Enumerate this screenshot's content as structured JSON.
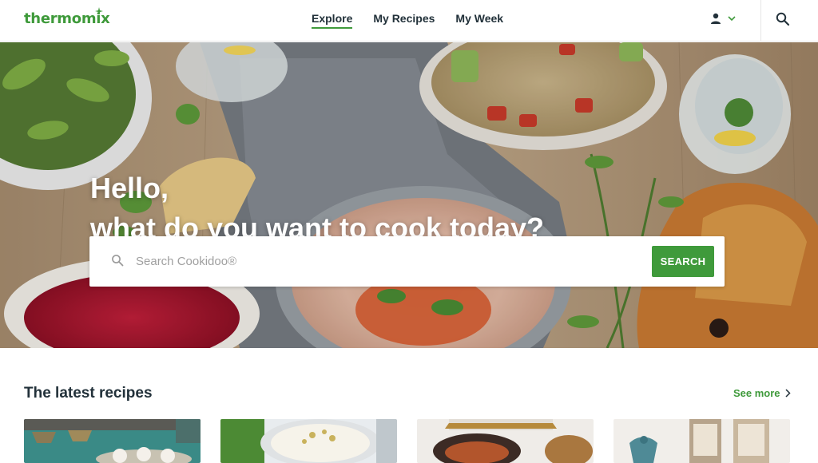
{
  "header": {
    "logo": "thermomix",
    "nav": [
      {
        "label": "Explore",
        "active": true
      },
      {
        "label": "My Recipes",
        "active": false
      },
      {
        "label": "My Week",
        "active": false
      }
    ],
    "icons": [
      "user-icon",
      "chevron-down-icon",
      "search-icon"
    ]
  },
  "hero": {
    "greeting": "Hello,",
    "question": "what do you want to cook today?",
    "search": {
      "placeholder": "Search Cookidoo®",
      "value": "",
      "button": "SEARCH"
    }
  },
  "latest": {
    "title": "The latest recipes",
    "see_more": "See more",
    "cards": [
      {
        "image": "dessert-cups-photo"
      },
      {
        "image": "rice-dish-photo"
      },
      {
        "image": "copper-pot-photo"
      },
      {
        "image": "lanterns-photo"
      }
    ]
  },
  "colors": {
    "brand_green": "#3f9a3b",
    "text_dark": "#22313a"
  }
}
